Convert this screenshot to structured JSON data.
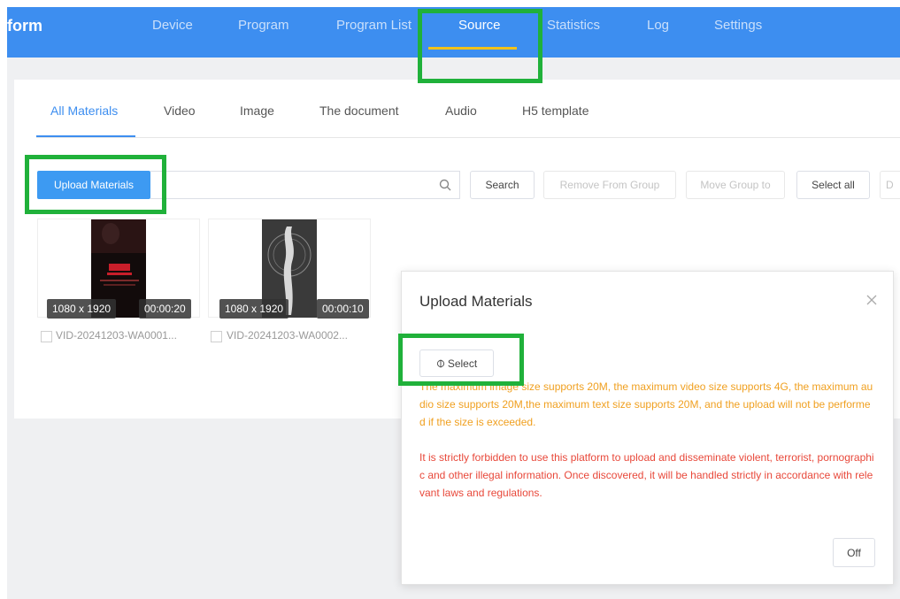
{
  "nav": {
    "brand": "form",
    "items": [
      "Device",
      "Program",
      "Program List",
      "Source",
      "Statistics",
      "Log",
      "Settings"
    ],
    "active": "Source"
  },
  "tabs": [
    "All Materials",
    "Video",
    "Image",
    "The document",
    "Audio",
    "H5 template"
  ],
  "toolbar": {
    "upload_label": "Upload Materials",
    "search_placeholder": "",
    "search_label": "Search",
    "remove_label": "Remove From Group",
    "move_label": "Move Group to",
    "select_all_label": "Select all",
    "extra_label": "D"
  },
  "materials": [
    {
      "resolution": "1080 x 1920",
      "duration": "00:00:20",
      "name": "VID-20241203-WA0001..."
    },
    {
      "resolution": "1080 x 1920",
      "duration": "00:00:10",
      "name": "VID-20241203-WA0002..."
    }
  ],
  "modal": {
    "title": "Upload Materials",
    "select_label": "Select",
    "notice_size": "The maximum image size supports 20M, the maximum video size supports 4G, the maximum audio size supports 20M,the maximum text size supports 20M, and the upload will not be performed if the size is exceeded.",
    "notice_legal": "It is strictly forbidden to use this platform to upload and disseminate violent, terrorist, pornographic and other illegal information. Once discovered, it will be handled strictly in accordance with relevant laws and regulations.",
    "off_label": "Off"
  },
  "colors": {
    "nav_bg": "#3d8ef0",
    "accent": "#3d8ef0",
    "active_underline": "#f2c21a",
    "highlight": "#20b13a",
    "notice_orange": "#f0a020",
    "notice_red": "#e8483a"
  },
  "icons": [
    "search-icon",
    "close-icon",
    "upload-icon"
  ]
}
